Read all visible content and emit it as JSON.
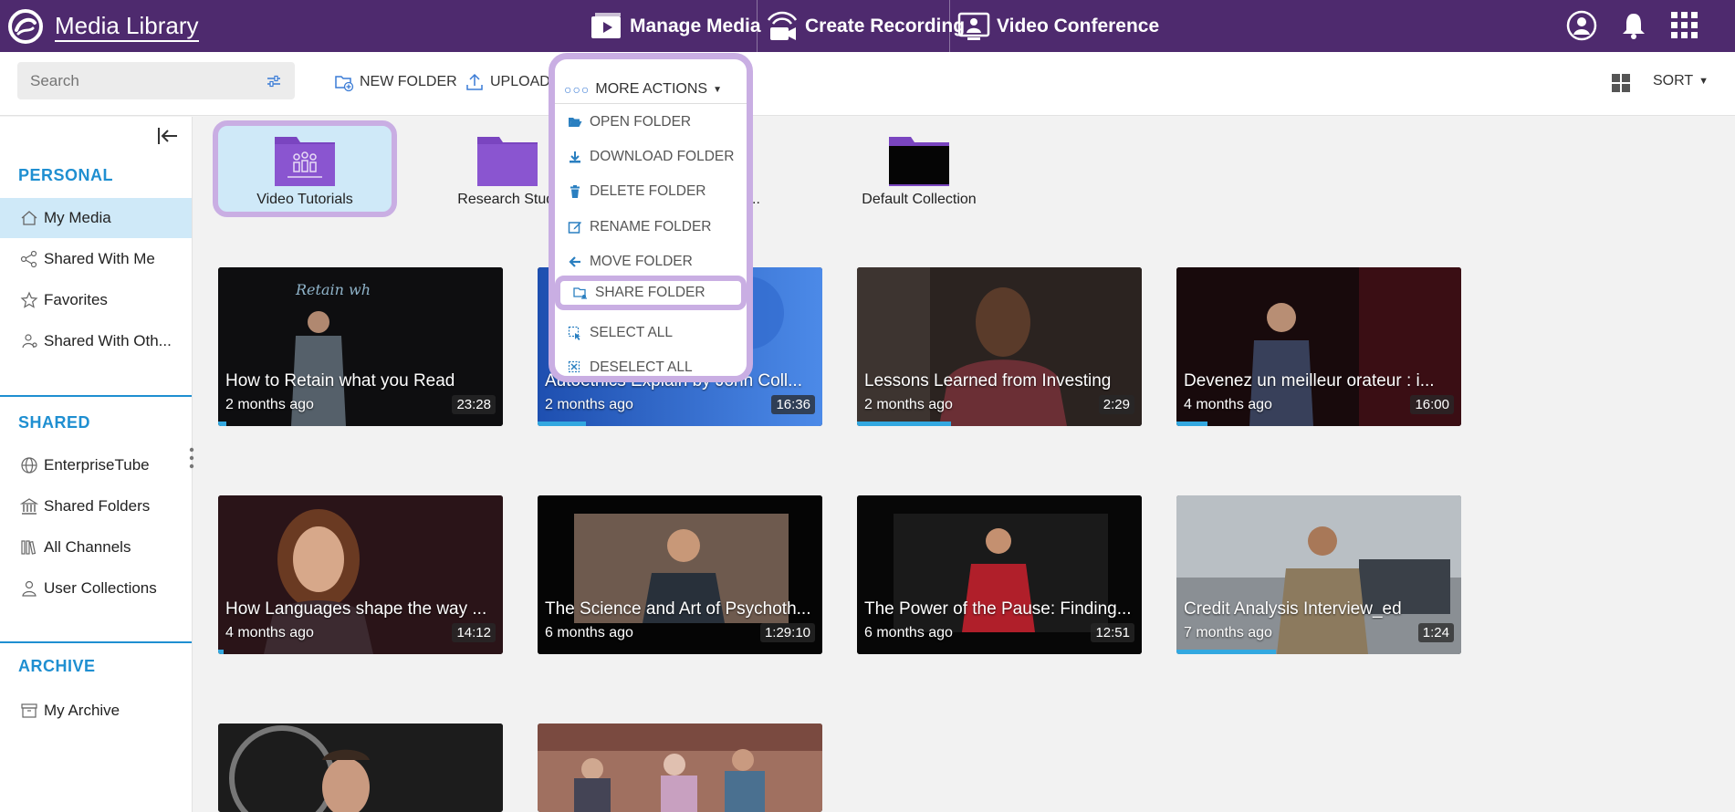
{
  "app": {
    "title": "Media Library"
  },
  "topnav": {
    "manage_media": "Manage Media",
    "create_recording": "Create Recording",
    "video_conference": "Video Conference"
  },
  "toolbar": {
    "search_placeholder": "Search",
    "new_folder": "NEW FOLDER",
    "upload": "UPLOAD",
    "more_actions": "MORE ACTIONS",
    "sort": "SORT"
  },
  "menu": {
    "items": [
      {
        "label": "OPEN FOLDER",
        "icon": "folder-open-icon"
      },
      {
        "label": "DOWNLOAD FOLDER",
        "icon": "download-icon"
      },
      {
        "label": "DELETE FOLDER",
        "icon": "trash-icon"
      },
      {
        "label": "RENAME FOLDER",
        "icon": "edit-icon"
      },
      {
        "label": "MOVE FOLDER",
        "icon": "arrow-left-icon"
      },
      {
        "label": "SHARE FOLDER",
        "icon": "share-folder-icon"
      },
      {
        "label": "SELECT ALL",
        "icon": "select-all-icon"
      },
      {
        "label": "DESELECT ALL",
        "icon": "deselect-all-icon"
      }
    ]
  },
  "sidebar": {
    "personal_title": "PERSONAL",
    "shared_title": "SHARED",
    "archive_title": "ARCHIVE",
    "personal": [
      {
        "label": "My Media",
        "icon": "home-icon"
      },
      {
        "label": "Shared With Me",
        "icon": "share-icon"
      },
      {
        "label": "Favorites",
        "icon": "star-icon"
      },
      {
        "label": "Shared With Oth...",
        "icon": "users-share-icon"
      }
    ],
    "shared": [
      {
        "label": "EnterpriseTube",
        "icon": "globe-icon"
      },
      {
        "label": "Shared Folders",
        "icon": "building-icon"
      },
      {
        "label": "All Channels",
        "icon": "library-icon"
      },
      {
        "label": "User Collections",
        "icon": "user-icon"
      }
    ],
    "archive": [
      {
        "label": "My Archive",
        "icon": "archive-icon"
      }
    ]
  },
  "folders": [
    {
      "name": "Video Tutorials"
    },
    {
      "name": "Research Studi"
    },
    {
      "name": "Rec..."
    },
    {
      "name": "Default Collection"
    }
  ],
  "videos": [
    {
      "title": "How to Retain what you Read",
      "age": "2 months ago",
      "duration": "23:28",
      "progress": 0.03
    },
    {
      "title": "Autoethics Explain by John Coll...",
      "age": "2 months ago",
      "duration": "16:36",
      "progress": 0.17
    },
    {
      "title": "Lessons Learned from Investing",
      "age": "2 months ago",
      "duration": "2:29",
      "progress": 0.33
    },
    {
      "title": "Devenez un meilleur orateur : i...",
      "age": "4 months ago",
      "duration": "16:00",
      "progress": 0.11
    },
    {
      "title": "How Languages shape the way ...",
      "age": "4 months ago",
      "duration": "14:12",
      "progress": 0.02
    },
    {
      "title": "The Science and Art of Psychoth...",
      "age": "6 months ago",
      "duration": "1:29:10",
      "progress": 0
    },
    {
      "title": "The Power of the Pause: Finding...",
      "age": "6 months ago",
      "duration": "12:51",
      "progress": 0
    },
    {
      "title": "Credit Analysis Interview_ed",
      "age": "7 months ago",
      "duration": "1:24",
      "progress": 0.35
    },
    {
      "title": "",
      "age": "",
      "duration": "",
      "progress": 0
    },
    {
      "title": "",
      "age": "",
      "duration": "",
      "progress": 0
    }
  ],
  "colors": {
    "topbar": "#4e2a6e",
    "accent": "#1f8fd1",
    "folder": "#7a45c0",
    "highlight": "#c9aee3",
    "progress": "#33a8e0"
  }
}
